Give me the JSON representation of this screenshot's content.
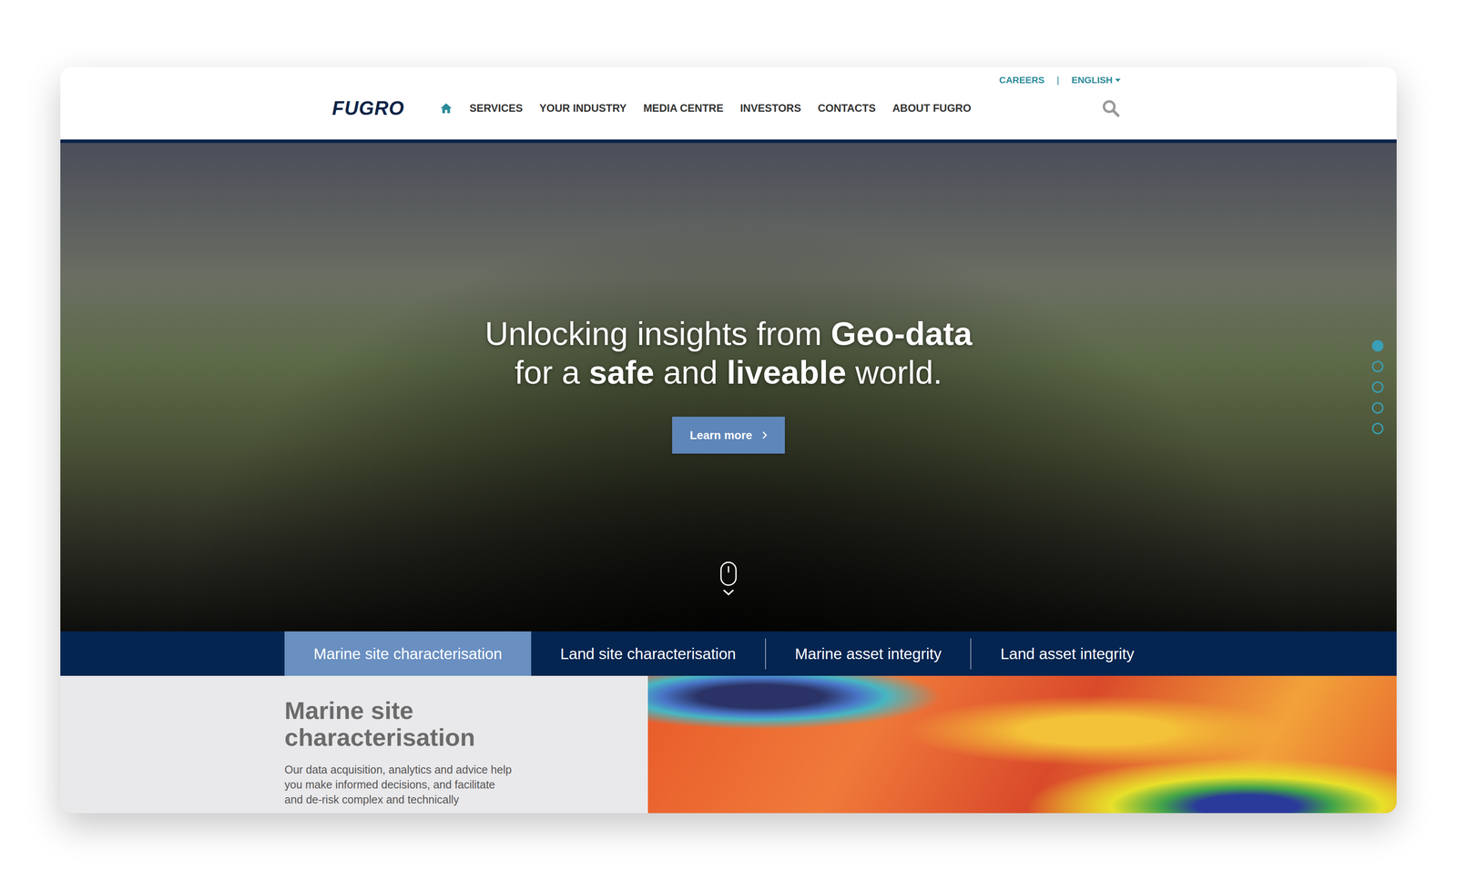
{
  "header": {
    "logo": "FUGRO",
    "utility_links": [
      {
        "label": "CAREERS",
        "dropdown": false
      },
      {
        "label": "ENGLISH",
        "dropdown": true
      }
    ],
    "utility_separator": "|",
    "nav": [
      {
        "label": "SERVICES"
      },
      {
        "label": "YOUR INDUSTRY"
      },
      {
        "label": "MEDIA CENTRE"
      },
      {
        "label": "INVESTORS"
      },
      {
        "label": "CONTACTS"
      },
      {
        "label": "ABOUT FUGRO"
      }
    ]
  },
  "hero": {
    "headline_lines": [
      [
        {
          "text": "Unlocking insights from ",
          "bold": false
        },
        {
          "text": "Geo-data",
          "bold": true
        }
      ],
      [
        {
          "text": "for a ",
          "bold": false
        },
        {
          "text": "safe",
          "bold": true
        },
        {
          "text": " and ",
          "bold": false
        },
        {
          "text": "liveable",
          "bold": true
        },
        {
          "text": " world.",
          "bold": false
        }
      ]
    ],
    "button": "Learn more",
    "slides": [
      {
        "selected": true
      },
      {
        "selected": false
      },
      {
        "selected": false
      },
      {
        "selected": false
      },
      {
        "selected": false
      }
    ]
  },
  "tabs": [
    {
      "label": "Marine site characterisation",
      "selected": true
    },
    {
      "label": "Land site characterisation",
      "selected": false
    },
    {
      "label": "Marine asset integrity",
      "selected": false
    },
    {
      "label": "Land asset integrity",
      "selected": false
    }
  ],
  "panel": {
    "title": "Marine site characterisation",
    "body_lines": [
      "Our data acquisition, analytics and advice help",
      "you make informed decisions, and facilitate",
      "and de-risk complex and technically"
    ]
  }
}
